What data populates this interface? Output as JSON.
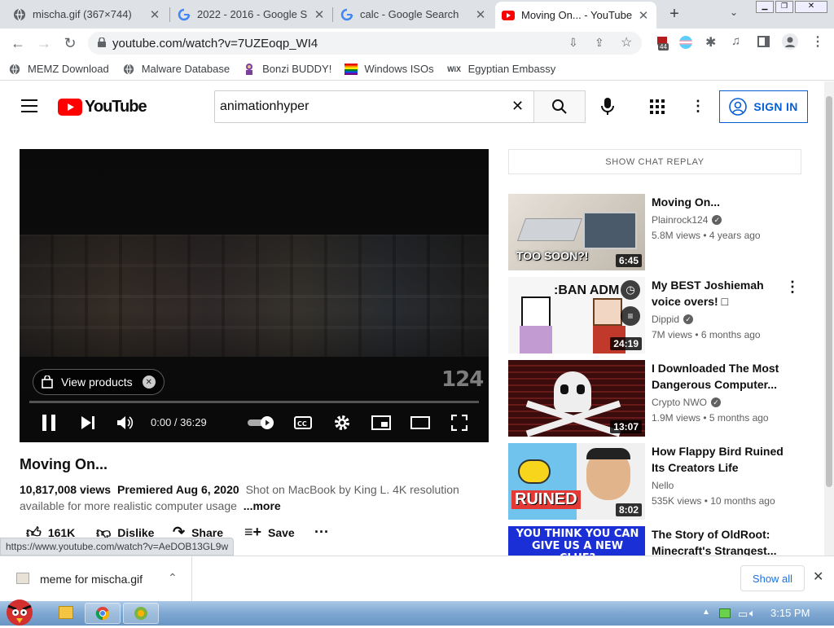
{
  "tabs": [
    {
      "title": "mischa.gif (367×744)",
      "icon": "globe-icon"
    },
    {
      "title": "2022 - 2016 - Google S",
      "icon": "google-icon"
    },
    {
      "title": "calc - Google Search",
      "icon": "google-icon"
    },
    {
      "title": "Moving On... - YouTube",
      "icon": "youtube-icon",
      "active": true
    }
  ],
  "address": {
    "url": "youtube.com/watch?v=7UZEoqp_WI4"
  },
  "extension_badge": "44",
  "bookmarks": [
    {
      "label": "MEMZ Download",
      "icon": "globe-icon"
    },
    {
      "label": "Malware Database",
      "icon": "globe-icon"
    },
    {
      "label": "Bonzi BUDDY!",
      "icon": "bonzi-icon"
    },
    {
      "label": "Windows ISOs",
      "icon": "rainbow-flag-icon"
    },
    {
      "label": "Egyptian Embassy",
      "icon": "wix-icon",
      "icon_text": "WiX"
    }
  ],
  "youtube": {
    "logo_text": "YouTube",
    "search_value": "animationhyper",
    "sign_in": "SIGN IN",
    "player": {
      "view_products": "View products",
      "time": "0:00 / 36:29",
      "watermark": "124"
    },
    "video": {
      "title": "Moving On...",
      "views": "10,817,008 views",
      "premiered": "Premiered Aug 6, 2020",
      "description": "Shot on MacBook by King L. 4K resolution available for more realistic computer usage",
      "more": "...more",
      "likes": "161K",
      "dislike": "Dislike",
      "share": "Share",
      "save": "Save"
    },
    "chat_replay": "SHOW CHAT REPLAY",
    "related": [
      {
        "title": "Moving On...",
        "channel": "Plainrock124",
        "verified": true,
        "stats": "5.8M views • 4 years ago",
        "duration": "6:45",
        "thumb_text": "TOO SOON?!",
        "thumb_color": "#d9d2c8"
      },
      {
        "title": "My BEST Joshiemah voice overs! □",
        "channel": "Dippid",
        "verified": true,
        "stats": "7M views • 6 months ago",
        "duration": "24:19",
        "thumb_text": ":BAN ADM",
        "thumb_color": "#f4f4f4"
      },
      {
        "title": "I Downloaded The Most Dangerous Computer...",
        "channel": "Crypto NWO",
        "verified": true,
        "stats": "1.9M views • 5 months ago",
        "duration": "13:07",
        "thumb_text": "",
        "thumb_color": "#5a1414"
      },
      {
        "title": "How Flappy Bird Ruined Its Creators Life",
        "channel": "Nello",
        "verified": false,
        "stats": "535K views • 10 months ago",
        "duration": "8:02",
        "thumb_text": "RUINED",
        "thumb_color": "#3d8fd6"
      },
      {
        "title": "The Story of OldRoot: Minecraft's Strangest...",
        "channel": "",
        "verified": false,
        "stats": "",
        "duration": "",
        "thumb_text": "YOU THINK YOU CAN GIVE US A NEW CLUE?",
        "thumb_color": "#1a2fd6"
      }
    ]
  },
  "status_url": "https://www.youtube.com/watch?v=AeDOB13GL9w",
  "download": {
    "filename": "meme for mischa.gif",
    "show_all": "Show all"
  },
  "taskbar": {
    "clock": "3:15 PM"
  }
}
